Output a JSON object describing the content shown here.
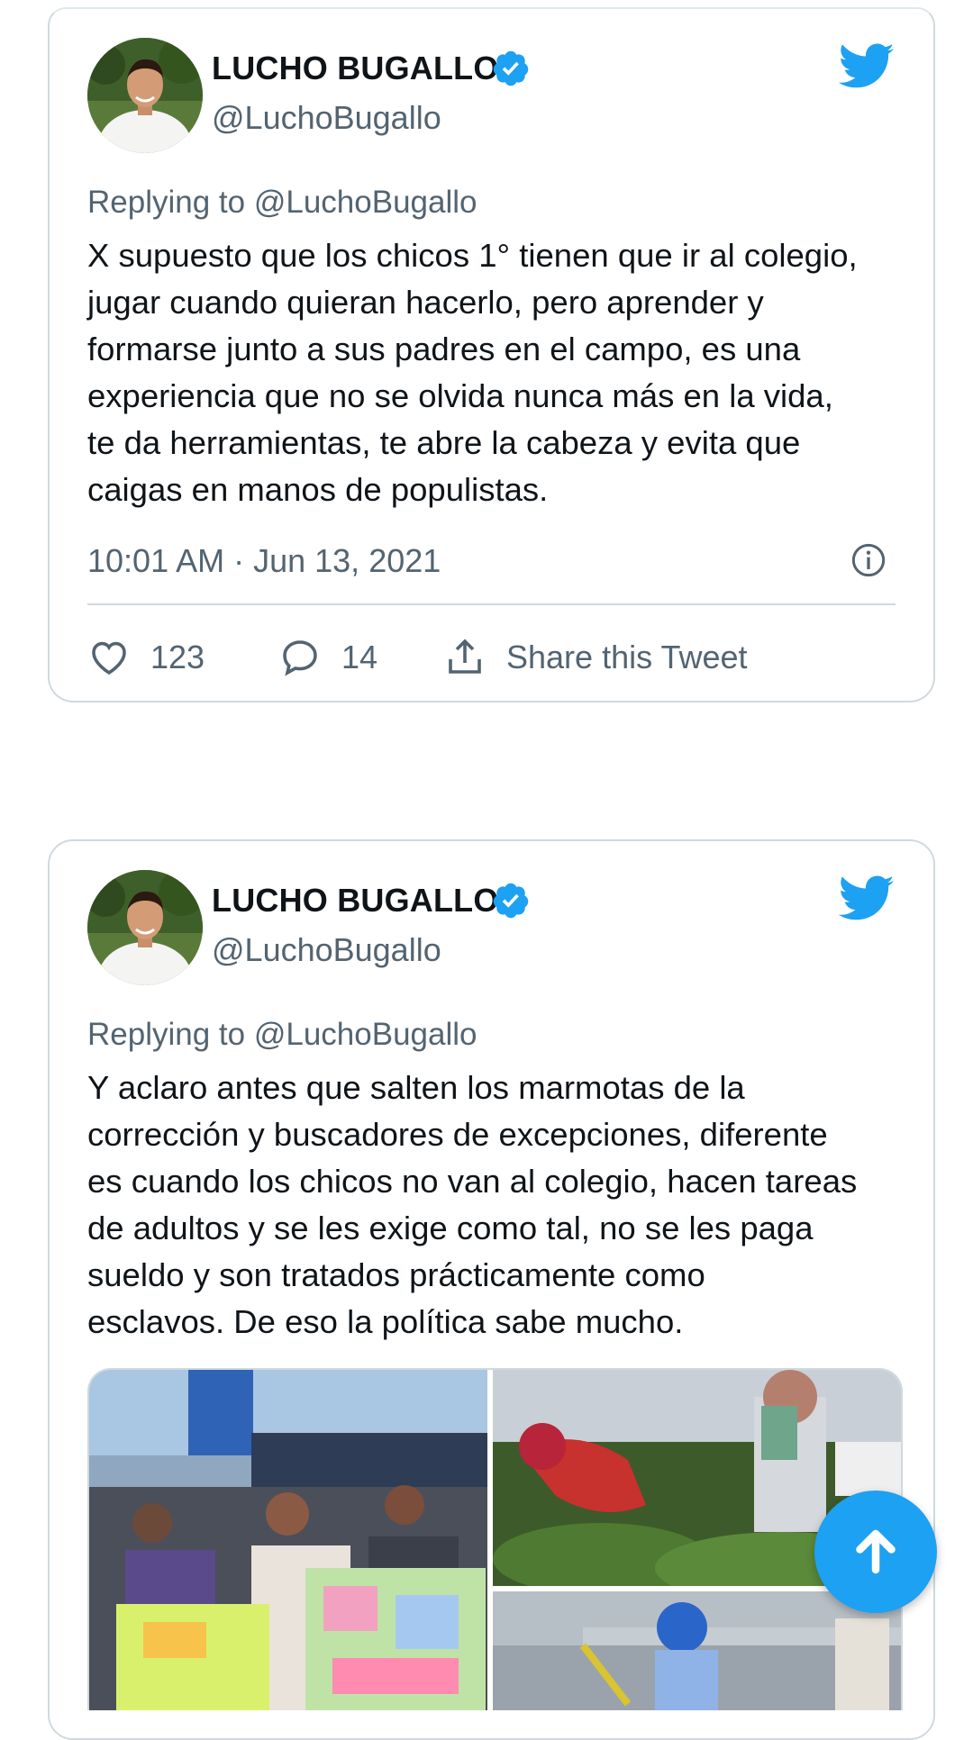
{
  "tweets": [
    {
      "author_name": "LUCHO BUGALLO",
      "handle": "@LuchoBugallo",
      "reply_prefix": "Replying to",
      "reply_handle": "@LuchoBugallo",
      "text_lines": [
        "X supuesto que los chicos 1° tienen que ir al colegio,",
        "jugar cuando quieran hacerlo, pero aprender y",
        "formarse junto a sus padres en el campo, es una",
        "experiencia que no se olvida nunca más en la vida,",
        "te da herramientas, te abre la cabeza y evita que",
        "caigas en manos de populistas."
      ],
      "timestamp": "10:01 AM · Jun 13, 2021",
      "likes": "123",
      "replies": "14",
      "share_label": "Share this Tweet"
    },
    {
      "author_name": "LUCHO BUGALLO",
      "handle": "@LuchoBugallo",
      "reply_prefix": "Replying to",
      "reply_handle": "@LuchoBugallo",
      "text_lines": [
        "Y aclaro antes que salten los marmotas de la",
        "corrección y buscadores de excepciones, diferente",
        "es cuando los chicos no van al colegio, hacen tareas",
        "de adultos y se les exige como tal, no se les paga",
        "sueldo y son tratados prácticamente como",
        "esclavos. De eso la política sabe mucho."
      ]
    }
  ],
  "colors": {
    "twitter_blue": "#1da1f2",
    "text_primary": "#0f1419",
    "text_secondary": "#536471",
    "border": "#cfd9de"
  },
  "icons": {
    "verified": "verified-badge-icon",
    "bird": "twitter-bird-icon",
    "info": "info-icon",
    "like": "heart-icon",
    "reply": "reply-bubble-icon",
    "share": "share-icon",
    "scroll_top": "arrow-up-icon"
  }
}
